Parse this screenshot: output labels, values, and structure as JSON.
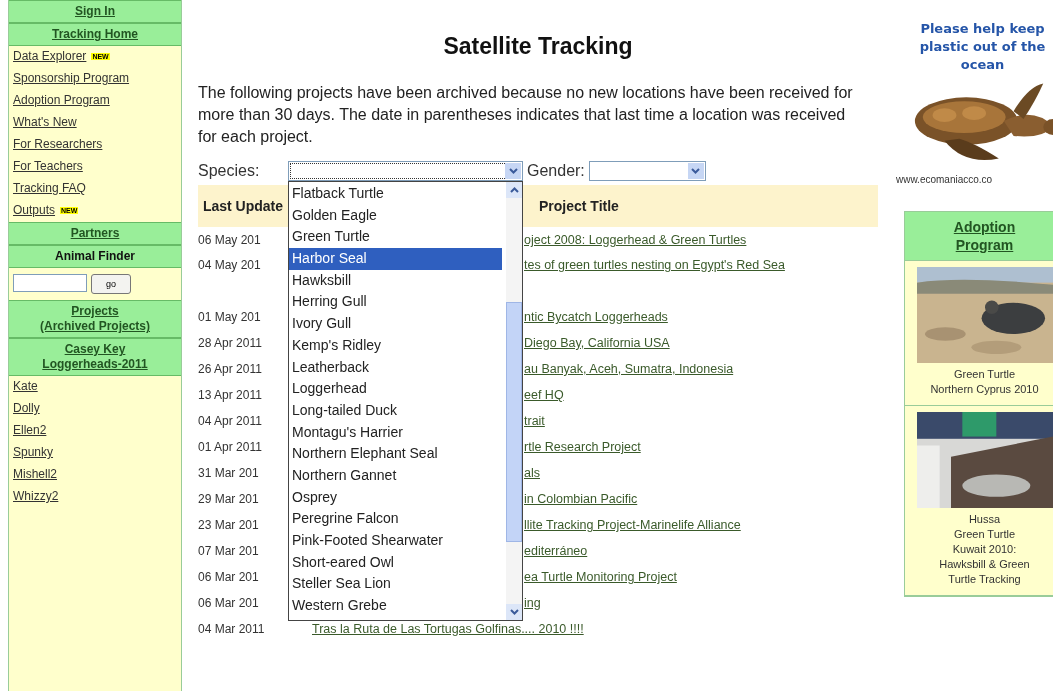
{
  "sidebar": [
    {
      "kind": "header",
      "lines": [
        "Sign In"
      ]
    },
    {
      "kind": "header",
      "lines": [
        "Tracking Home"
      ]
    },
    {
      "kind": "link",
      "text": "Data Explorer",
      "badge": "NEW"
    },
    {
      "kind": "link",
      "text": "Sponsorship Program"
    },
    {
      "kind": "link",
      "text": "Adoption Program"
    },
    {
      "kind": "link",
      "text": "What's New"
    },
    {
      "kind": "link",
      "text": "For Researchers"
    },
    {
      "kind": "link",
      "text": "For Teachers"
    },
    {
      "kind": "link",
      "text": "Tracking FAQ"
    },
    {
      "kind": "link",
      "text": "Outputs",
      "badge": "NEW"
    },
    {
      "kind": "header",
      "lines": [
        "Partners"
      ]
    },
    {
      "kind": "label",
      "lines": [
        "Animal Finder"
      ]
    },
    {
      "kind": "search",
      "button": "go"
    },
    {
      "kind": "header",
      "lines": [
        "Projects",
        "(Archived Projects)"
      ]
    },
    {
      "kind": "header",
      "lines": [
        "Casey Key",
        "Loggerheads-2011"
      ]
    },
    {
      "kind": "link",
      "text": "Kate"
    },
    {
      "kind": "link",
      "text": "Dolly"
    },
    {
      "kind": "link",
      "text": "Ellen2"
    },
    {
      "kind": "link",
      "text": "Spunky"
    },
    {
      "kind": "link",
      "text": "Mishell2"
    },
    {
      "kind": "link",
      "text": "Whizzy2"
    }
  ],
  "title": "Satellite Tracking",
  "intro": "The following projects have been archived because no new locations have been received for more than 30 days. The date in parentheses indicates that last time a location was received for each project.",
  "filters": {
    "species_label": "Species:",
    "gender_label": "Gender:"
  },
  "species_options": [
    {
      "text": "Flatback Turtle",
      "selected": false
    },
    {
      "text": "Golden Eagle",
      "selected": false
    },
    {
      "text": "Green Turtle",
      "selected": false
    },
    {
      "text": "Harbor Seal",
      "selected": true
    },
    {
      "text": "Hawksbill",
      "selected": false
    },
    {
      "text": "Herring Gull",
      "selected": false
    },
    {
      "text": "Ivory Gull",
      "selected": false
    },
    {
      "text": "Kemp's Ridley",
      "selected": false
    },
    {
      "text": "Leatherback",
      "selected": false
    },
    {
      "text": "Loggerhead",
      "selected": false
    },
    {
      "text": "Long-tailed Duck",
      "selected": false
    },
    {
      "text": "Montagu's Harrier",
      "selected": false
    },
    {
      "text": "Northern Elephant Seal",
      "selected": false
    },
    {
      "text": "Northern Gannet",
      "selected": false
    },
    {
      "text": "Osprey",
      "selected": false
    },
    {
      "text": "Peregrine Falcon",
      "selected": false
    },
    {
      "text": "Pink-Footed Shearwater",
      "selected": false
    },
    {
      "text": "Short-eared Owl",
      "selected": false
    },
    {
      "text": "Steller Sea Lion",
      "selected": false
    },
    {
      "text": "Western Grebe",
      "selected": false
    }
  ],
  "table": {
    "columns": [
      "Last Update",
      "Project Title"
    ],
    "rows": [
      {
        "kind": "covered",
        "date": "06 May 201",
        "title": "oject 2008: Loggerhead & Green Turtles"
      },
      {
        "kind": "wrapped",
        "date": "04 May 201",
        "title": "tes of green turtles nesting on Egypt's Red Sea"
      },
      {
        "kind": "covered",
        "date": "01 May 201",
        "title": "ntic Bycatch Loggerheads"
      },
      {
        "kind": "covered",
        "date": "28 Apr 2011",
        "title": "Diego Bay, California USA"
      },
      {
        "kind": "covered",
        "date": "26 Apr 2011",
        "title": "au Banyak, Aceh, Sumatra, Indonesia"
      },
      {
        "kind": "covered",
        "date": "13 Apr 2011",
        "title": "eef HQ"
      },
      {
        "kind": "covered",
        "date": "04 Apr 2011",
        "title": "trait"
      },
      {
        "kind": "covered",
        "date": "01 Apr 2011",
        "title": "rtle Research Project"
      },
      {
        "kind": "covered",
        "date": "31 Mar 201",
        "title": "als"
      },
      {
        "kind": "covered",
        "date": "29 Mar 201",
        "title": "in Colombian Pacific"
      },
      {
        "kind": "covered",
        "date": "23 Mar 201",
        "title": "llite Tracking Project-Marinelife Alliance"
      },
      {
        "kind": "covered",
        "date": "07 Mar 201",
        "title": "editerráneo"
      },
      {
        "kind": "covered",
        "date": "06 Mar 201",
        "title": "ea Turtle Monitoring Project"
      },
      {
        "kind": "covered",
        "date": "06 Mar 201",
        "title": "ing"
      },
      {
        "kind": "full",
        "date": "04 Mar 2011",
        "title": "Tras la Ruta de Las Tortugas Golfinas.... 2010 !!!!"
      }
    ]
  },
  "ad": {
    "text": "Please help keep plastic out of the ocean",
    "url": "www.ecomaniacco.co"
  },
  "adoption": {
    "title": "Adoption Program",
    "cards": [
      {
        "lines": [
          "Green Turtle",
          "Northern Cyprus 2010"
        ]
      },
      {
        "lines": [
          "Hussa",
          "Green Turtle",
          "Kuwait 2010:",
          "Hawksbill & Green",
          "Turtle Tracking"
        ]
      }
    ]
  }
}
